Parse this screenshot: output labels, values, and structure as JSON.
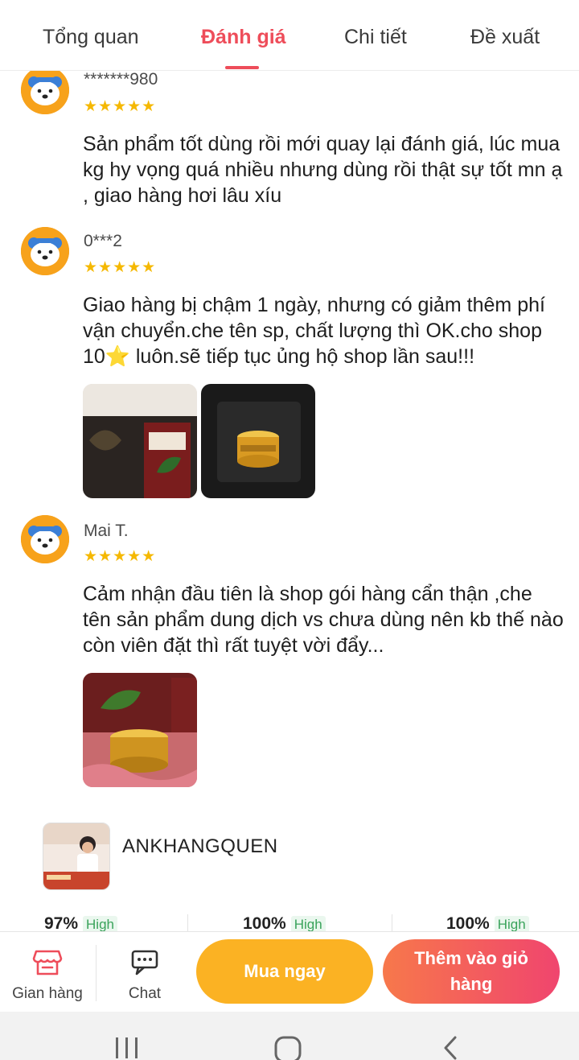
{
  "tabs": [
    {
      "label": "Tổng quan",
      "active": false
    },
    {
      "label": "Đánh giá",
      "active": true
    },
    {
      "label": "Chi tiết",
      "active": false
    },
    {
      "label": "Đề xuất",
      "active": false
    }
  ],
  "reviews": [
    {
      "name": "*******980",
      "rating": 5,
      "stars": "★★★★★",
      "text": "Sản phẩm tốt dùng rồi mới quay lại đánh giá, lúc mua kg hy vọng quá nhiều nhưng dùng rồi thật sự tốt mn ạ , giao hàng hơi lâu xíu",
      "photos": 0
    },
    {
      "name": "0***2",
      "rating": 5,
      "stars": "★★★★★",
      "text": "Giao hàng bị chậm 1 ngày, nhưng có giảm thêm phí vận chuyển.che tên sp, chất lượng thì OK.cho shop 10⭐ luôn.sẽ tiếp tục ủng hộ shop lần sau!!!",
      "photos": 2
    },
    {
      "name": "Mai T.",
      "rating": 5,
      "stars": "★★★★★",
      "text": "Cảm nhận đầu tiên là shop gói hàng cẩn thận ,che tên sản phẩm dung dịch vs chưa dùng nên kb thế nào còn viên đặt thì rất tuyệt vời đẩy...",
      "photos": 1
    }
  ],
  "shop": {
    "name": "ANKHANGQUEN",
    "stats": [
      {
        "value": "97%",
        "level": "High"
      },
      {
        "value": "100%",
        "level": "High"
      },
      {
        "value": "100%",
        "level": "High"
      }
    ]
  },
  "action_bar": {
    "store_label": "Gian hàng",
    "chat_label": "Chat",
    "buy_now_label": "Mua ngay",
    "add_to_cart_label": "Thêm vào giỏ hàng"
  },
  "colors": {
    "accent": "#ee4d5a",
    "star": "#f5b800",
    "buy_now": "#fbb223",
    "add_to_cart_start": "#f7784b",
    "add_to_cart_end": "#f0456e",
    "level_text": "#3aa35b"
  },
  "icons": {
    "store": "store-icon",
    "chat": "chat-icon",
    "recent_apps": "recent-apps-icon",
    "home": "home-icon",
    "back": "back-icon"
  }
}
